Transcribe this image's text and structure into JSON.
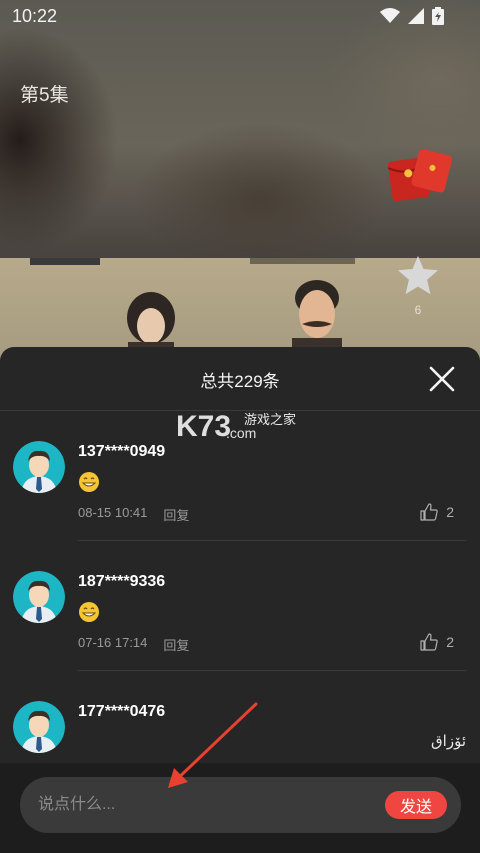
{
  "status_bar": {
    "time": "10:22"
  },
  "video": {
    "episode_label": "第5集",
    "favorite_count": "6"
  },
  "comments_sheet": {
    "title": "总共229条",
    "comments": [
      {
        "username": "137****0949",
        "date": "08-15 10:41",
        "reply_label": "回复",
        "likes": "2",
        "emoji": "grinning-face-emoji"
      },
      {
        "username": "187****9336",
        "date": "07-16 17:14",
        "reply_label": "回复",
        "likes": "2",
        "emoji": "grinning-face-emoji"
      },
      {
        "username": "177****0476"
      }
    ]
  },
  "watermark": {
    "brand": "K73",
    "site_cn": "游戏之家",
    "domain": ".com",
    "footer_text": "ئۆزاق"
  },
  "input_bar": {
    "placeholder": "说点什么...",
    "send_label": "发送"
  },
  "colors": {
    "sheet_bg": "#262626",
    "send_button": "#f04642",
    "arrow": "#e8412f"
  },
  "icons": [
    "wifi-icon",
    "signal-icon",
    "battery-icon",
    "red-packet-icon",
    "star-icon",
    "close-icon",
    "avatar-icon",
    "thumb-up-icon"
  ]
}
